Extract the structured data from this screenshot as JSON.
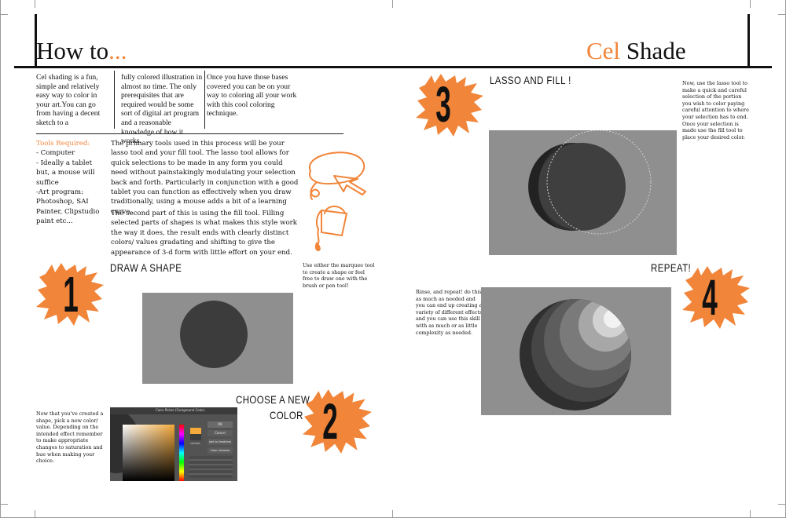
{
  "header": {
    "title_left_prefix": "How to",
    "title_left_suffix": "...",
    "title_right_accent": "Cel",
    "title_right_main": " Shade"
  },
  "intro": {
    "col1": "Cel shading is a fun, simple and relatively easy way to color in your art.You can go from having a decent sketch to a",
    "col2": "fully colored illustration in almost no time. The only prerequisites that are required would be some sort of digital art program and a reasonable knowledge of how it works.",
    "col3": "Once you have those bases covered you can be on your way to coloring all your work with this cool coloring technique."
  },
  "tools": {
    "heading": "Tools Required:",
    "lines": [
      "- Computer",
      "- Ideally a tablet but, a mouse will suffice",
      "-Art program: Photoshop, SAI Painter, Clipstudio paint etc..."
    ]
  },
  "main_text": {
    "p1": "The primary tools used in this process will be your lasso tool and your fill tool. The lasso tool allows for quick selections to be made in any form you could need without painstakingly modulating your selection back and forth. Particularly in conjunction with a good tablet you can function as effectively when you draw traditionally, using a mouse adds a bit of a learning curve.",
    "p2": "The second part of this is using the fill tool. Filling selected parts of shapes is what makes this style work the way it does, the result ends with clearly distinct colors/ values gradating and shifting to give the appearance of 3-d form with little effort on your end."
  },
  "steps": [
    {
      "number": "1",
      "title": "DRAW A SHAPE",
      "caption": "Use either the marquee tool to create a shape or feel free to draw one with the brush or pen tool!"
    },
    {
      "number": "2",
      "title": "CHOOSE A NEW COLOR",
      "title_line1": "CHOOSE A NEW",
      "title_line2": "COLOR",
      "caption": "Now that you've created a shape, pick a new color/ value. Depending on the intended effect remember to make appropriate changes to saturation and hue when making your choice."
    },
    {
      "number": "3",
      "title": "LASSO AND FILL !",
      "caption": "Now, use the lasso tool to make a quick and careful selection of the portion you wish to color paying careful attention to where your selection has to end. Once your selection is made use the fill tool to place your desired color."
    },
    {
      "number": "4",
      "title": "REPEAT!",
      "caption": "Rinse, and repeat! do this as much as needed and you can end up creating a variety of different effects and you can use this skill with as much or as little complexity as needed."
    }
  ],
  "color_picker": {
    "title": "Color Picker (Foreground Color)",
    "ok": "OK",
    "cancel": "Cancel",
    "add_swatches": "Add to Swatches",
    "libraries": "Color Libraries",
    "current": "current"
  },
  "colors": {
    "accent": "#f1853a",
    "panel": "#8f8f8f",
    "shape": "#3c3c3c"
  }
}
